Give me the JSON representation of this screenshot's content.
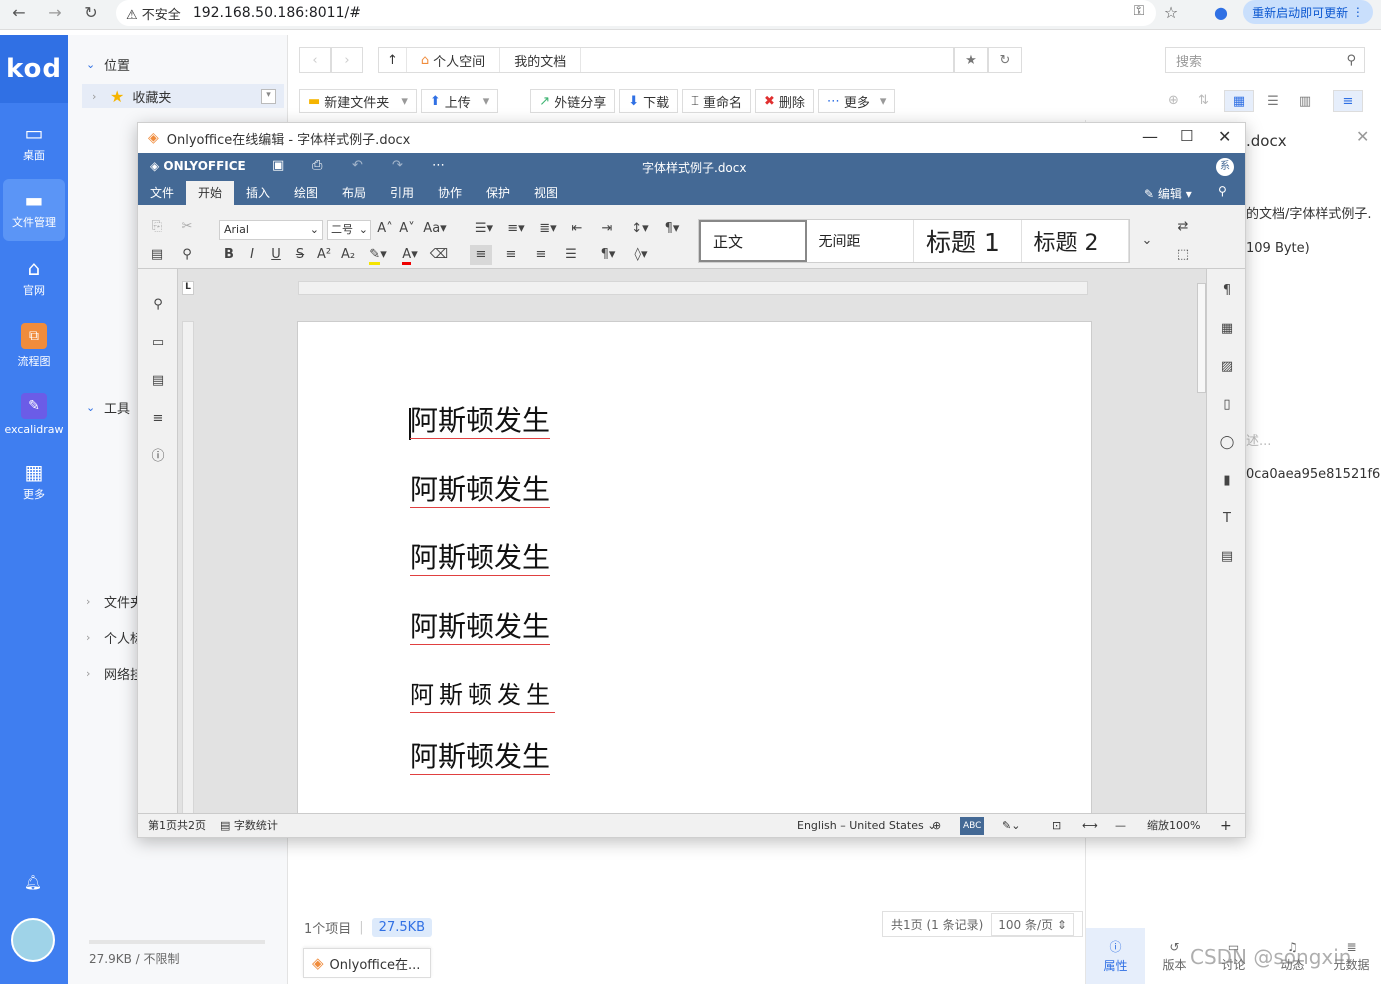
{
  "browser": {
    "insecure_label": "不安全",
    "url": "192.168.50.186:8011/#",
    "update_label": "重新启动即可更新"
  },
  "kod": {
    "logo": "kod",
    "nav": [
      {
        "label": "桌面",
        "icon": "monitor-icon"
      },
      {
        "label": "文件管理",
        "icon": "folder-icon"
      },
      {
        "label": "官网",
        "icon": "home-icon"
      },
      {
        "label": "流程图",
        "icon": "flowchart-icon"
      },
      {
        "label": "excalidraw",
        "icon": "excalidraw-icon"
      },
      {
        "label": "更多",
        "icon": "grid-icon"
      }
    ]
  },
  "tree": {
    "location_label": "位置",
    "favorites_label": "收藏夹",
    "tools_label": "工具",
    "bottom_items": [
      "文件夹",
      "个人标",
      "网络挂"
    ],
    "storage": "27.9KB / 不限制"
  },
  "header": {
    "path": [
      "个人空间",
      "我的文档"
    ],
    "search_placeholder": "搜索"
  },
  "toolbar": {
    "new_folder": "新建文件夹",
    "upload": "上传",
    "share": "外链分享",
    "download": "下载",
    "rename": "重命名",
    "delete": "删除",
    "more": "更多"
  },
  "rightpanel": {
    "filename": ".docx",
    "path": "的文档/字体样式例子.",
    "size": "109 Byte)",
    "desc": "述...",
    "hash": "0ca0aea95e81521f6...",
    "tabs": [
      "属性",
      "版本",
      "讨论",
      "动态",
      "元数据"
    ]
  },
  "status": {
    "items": "1个项目",
    "size": "27.5KB",
    "pager": "共1页 (1 条记录)",
    "per_page": "100 条/页"
  },
  "taskbar": {
    "label": "Onlyoffice在..."
  },
  "watermark": "CSDN @songxin",
  "oo": {
    "window_title": "Onlyoffice在线编辑 - 字体样式例子.docx",
    "brand": "ONLYOFFICE",
    "doc_title": "字体样式例子.docx",
    "avatar": "系",
    "edit_mode": "编辑",
    "tabs": [
      "文件",
      "开始",
      "插入",
      "绘图",
      "布局",
      "引用",
      "协作",
      "保护",
      "视图"
    ],
    "font_name": "Arial",
    "font_size": "二号",
    "styles": [
      "正文",
      "无间距",
      "标题 1",
      "标题 2"
    ],
    "paragraphs": [
      "阿斯顿发生",
      "阿斯顿发生",
      "阿斯顿发生",
      "阿斯顿发生",
      "阿斯顿发生",
      "阿斯顿发生"
    ],
    "status": {
      "page": "第1页共2页",
      "wordcount": "字数统计",
      "language": "English – United States",
      "zoom": "缩放100%"
    }
  }
}
